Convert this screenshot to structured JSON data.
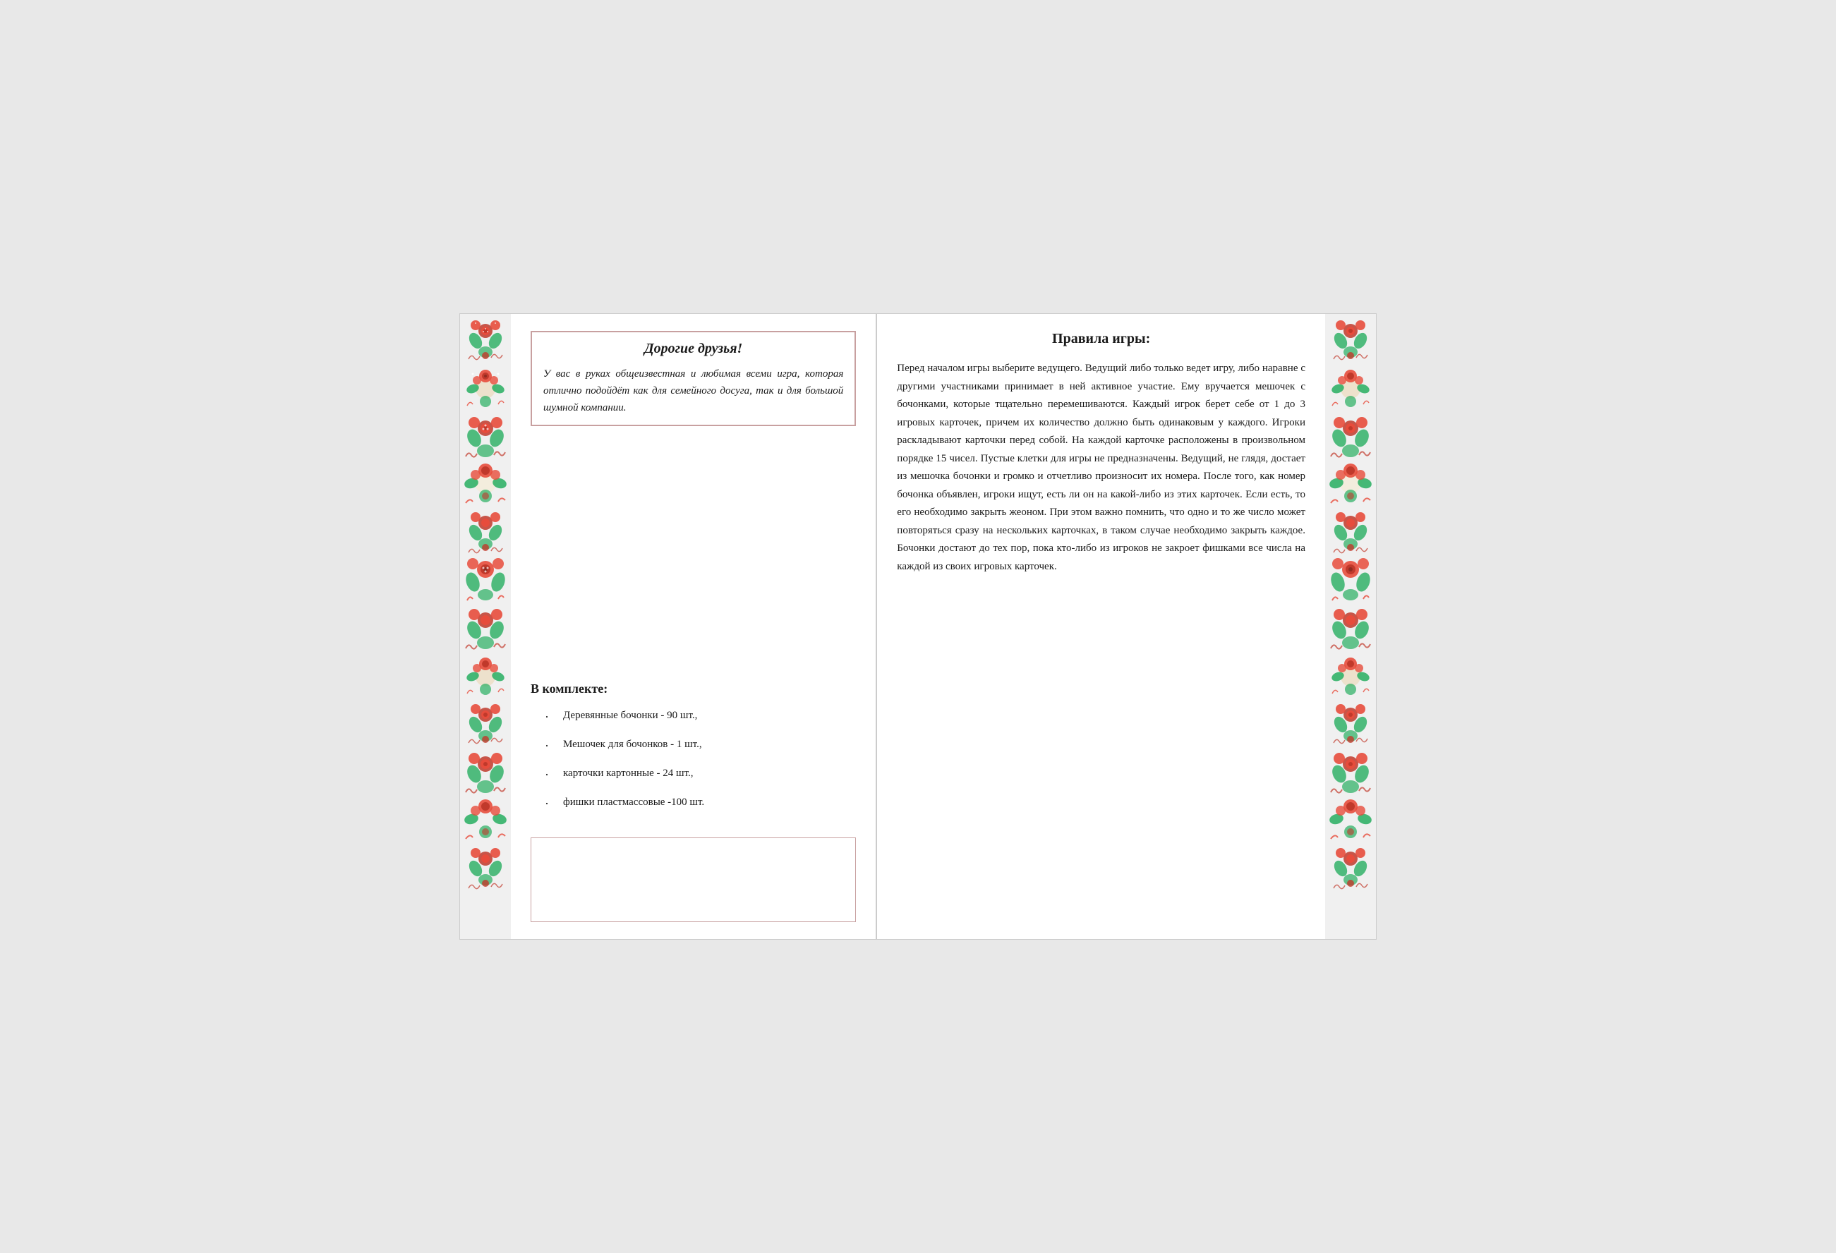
{
  "page": {
    "dear_friends_title": "Дорогие друзья!",
    "dear_friends_text": "У вас в руках общеизвестная и любимая всеми игра, которая отлично подойдёт как для семейного досуга, так и для большой шумной компании.",
    "kit_title": "В комплекте:",
    "kit_items": [
      "Деревянные бочонки - 90 шт.,",
      "Мешочек для бочонков - 1 шт.,",
      "карточки картонные - 24 шт.,",
      "фишки пластмассовые -100 шт."
    ],
    "rules_title": "Правила игры:",
    "rules_text": "Перед началом игры выберите ведущего. Ведущий либо только ведет игру, либо наравне с другими участниками принимает в ней  активное участие. Ему вручается мешочек с бочонками, которые тщательно перемешиваются. Каждый игрок берет себе от 1 до 3 игровых карточек, причем их количество должно быть одинаковым у каждого. Игроки раскладывают карточки перед собой. На каждой карточке расположены в произвольном порядке 15 чисел. Пустые клетки для игры не предназначены. Ведущий, не глядя, достает из мешочка бочонки и громко и отчетливо  произносит их номера. После того, как номер бочонка объявлен, игроки ищут, есть ли он на какой-либо из этих карточек. Если есть, то его необходимо закрыть жеоном. При этом важно помнить, что одно и то же число может повторяться сразу на нескольких карточках, в таком случае необходимо закрыть каждое.  Бочонки достают до тех пор, пока кто-либо из игроков не закроет фишками все числа на каждой из своих игровых карточек."
  }
}
